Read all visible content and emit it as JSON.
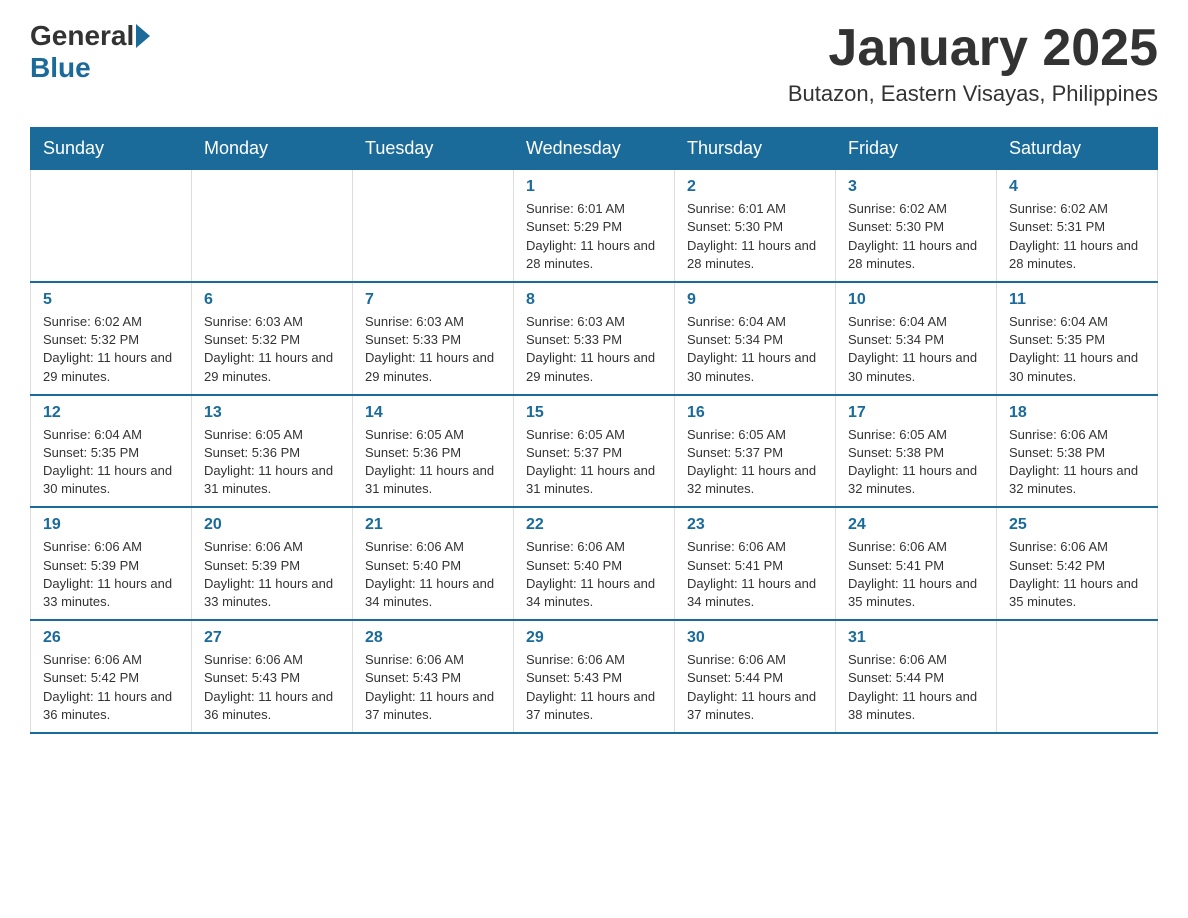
{
  "header": {
    "logo": {
      "general": "General",
      "blue": "Blue"
    },
    "title": "January 2025",
    "subtitle": "Butazon, Eastern Visayas, Philippines"
  },
  "days_of_week": [
    "Sunday",
    "Monday",
    "Tuesday",
    "Wednesday",
    "Thursday",
    "Friday",
    "Saturday"
  ],
  "weeks": [
    {
      "days": [
        {
          "number": "",
          "info": ""
        },
        {
          "number": "",
          "info": ""
        },
        {
          "number": "",
          "info": ""
        },
        {
          "number": "1",
          "info": "Sunrise: 6:01 AM\nSunset: 5:29 PM\nDaylight: 11 hours and 28 minutes."
        },
        {
          "number": "2",
          "info": "Sunrise: 6:01 AM\nSunset: 5:30 PM\nDaylight: 11 hours and 28 minutes."
        },
        {
          "number": "3",
          "info": "Sunrise: 6:02 AM\nSunset: 5:30 PM\nDaylight: 11 hours and 28 minutes."
        },
        {
          "number": "4",
          "info": "Sunrise: 6:02 AM\nSunset: 5:31 PM\nDaylight: 11 hours and 28 minutes."
        }
      ]
    },
    {
      "days": [
        {
          "number": "5",
          "info": "Sunrise: 6:02 AM\nSunset: 5:32 PM\nDaylight: 11 hours and 29 minutes."
        },
        {
          "number": "6",
          "info": "Sunrise: 6:03 AM\nSunset: 5:32 PM\nDaylight: 11 hours and 29 minutes."
        },
        {
          "number": "7",
          "info": "Sunrise: 6:03 AM\nSunset: 5:33 PM\nDaylight: 11 hours and 29 minutes."
        },
        {
          "number": "8",
          "info": "Sunrise: 6:03 AM\nSunset: 5:33 PM\nDaylight: 11 hours and 29 minutes."
        },
        {
          "number": "9",
          "info": "Sunrise: 6:04 AM\nSunset: 5:34 PM\nDaylight: 11 hours and 30 minutes."
        },
        {
          "number": "10",
          "info": "Sunrise: 6:04 AM\nSunset: 5:34 PM\nDaylight: 11 hours and 30 minutes."
        },
        {
          "number": "11",
          "info": "Sunrise: 6:04 AM\nSunset: 5:35 PM\nDaylight: 11 hours and 30 minutes."
        }
      ]
    },
    {
      "days": [
        {
          "number": "12",
          "info": "Sunrise: 6:04 AM\nSunset: 5:35 PM\nDaylight: 11 hours and 30 minutes."
        },
        {
          "number": "13",
          "info": "Sunrise: 6:05 AM\nSunset: 5:36 PM\nDaylight: 11 hours and 31 minutes."
        },
        {
          "number": "14",
          "info": "Sunrise: 6:05 AM\nSunset: 5:36 PM\nDaylight: 11 hours and 31 minutes."
        },
        {
          "number": "15",
          "info": "Sunrise: 6:05 AM\nSunset: 5:37 PM\nDaylight: 11 hours and 31 minutes."
        },
        {
          "number": "16",
          "info": "Sunrise: 6:05 AM\nSunset: 5:37 PM\nDaylight: 11 hours and 32 minutes."
        },
        {
          "number": "17",
          "info": "Sunrise: 6:05 AM\nSunset: 5:38 PM\nDaylight: 11 hours and 32 minutes."
        },
        {
          "number": "18",
          "info": "Sunrise: 6:06 AM\nSunset: 5:38 PM\nDaylight: 11 hours and 32 minutes."
        }
      ]
    },
    {
      "days": [
        {
          "number": "19",
          "info": "Sunrise: 6:06 AM\nSunset: 5:39 PM\nDaylight: 11 hours and 33 minutes."
        },
        {
          "number": "20",
          "info": "Sunrise: 6:06 AM\nSunset: 5:39 PM\nDaylight: 11 hours and 33 minutes."
        },
        {
          "number": "21",
          "info": "Sunrise: 6:06 AM\nSunset: 5:40 PM\nDaylight: 11 hours and 34 minutes."
        },
        {
          "number": "22",
          "info": "Sunrise: 6:06 AM\nSunset: 5:40 PM\nDaylight: 11 hours and 34 minutes."
        },
        {
          "number": "23",
          "info": "Sunrise: 6:06 AM\nSunset: 5:41 PM\nDaylight: 11 hours and 34 minutes."
        },
        {
          "number": "24",
          "info": "Sunrise: 6:06 AM\nSunset: 5:41 PM\nDaylight: 11 hours and 35 minutes."
        },
        {
          "number": "25",
          "info": "Sunrise: 6:06 AM\nSunset: 5:42 PM\nDaylight: 11 hours and 35 minutes."
        }
      ]
    },
    {
      "days": [
        {
          "number": "26",
          "info": "Sunrise: 6:06 AM\nSunset: 5:42 PM\nDaylight: 11 hours and 36 minutes."
        },
        {
          "number": "27",
          "info": "Sunrise: 6:06 AM\nSunset: 5:43 PM\nDaylight: 11 hours and 36 minutes."
        },
        {
          "number": "28",
          "info": "Sunrise: 6:06 AM\nSunset: 5:43 PM\nDaylight: 11 hours and 37 minutes."
        },
        {
          "number": "29",
          "info": "Sunrise: 6:06 AM\nSunset: 5:43 PM\nDaylight: 11 hours and 37 minutes."
        },
        {
          "number": "30",
          "info": "Sunrise: 6:06 AM\nSunset: 5:44 PM\nDaylight: 11 hours and 37 minutes."
        },
        {
          "number": "31",
          "info": "Sunrise: 6:06 AM\nSunset: 5:44 PM\nDaylight: 11 hours and 38 minutes."
        },
        {
          "number": "",
          "info": ""
        }
      ]
    }
  ]
}
